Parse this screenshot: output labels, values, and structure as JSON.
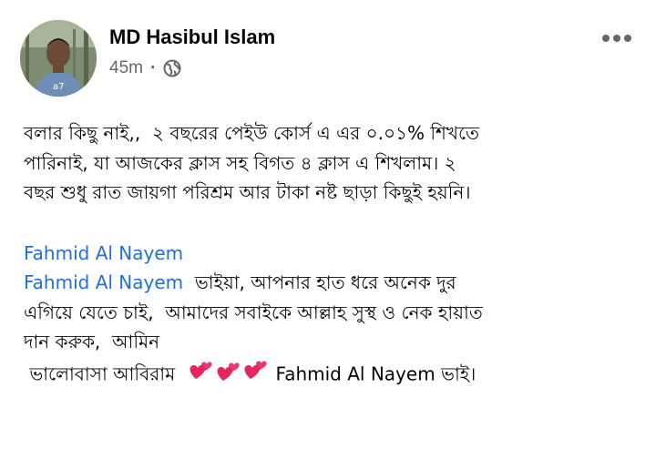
{
  "post": {
    "author": "MD Hasibul Islam",
    "time": "45m",
    "privacy_icon": "globe-icon",
    "menu_icon": "more-horizontal-icon",
    "paragraph1": "বলার কিছু নাই,,  ২ বছরের পেইউ কোর্স এ এর ০.০১% শিখতে\nপারিনাই, যা আজকের ক্লাস সহ বিগত ৪ ক্লাস এ শিখলাম। ২\nবছর শুধু রাত জায়গা পরিশ্রম আর টাকা নষ্ট ছাড়া কিছুই হয়নি।",
    "mention_1": "Fahmid Al Nayem",
    "mention_2": "Fahmid Al Nayem",
    "line_after_mention": "  ভাইয়া, আপনার হাত ধরে অনেক দুর",
    "paragraph2_rest": "এগিয়ে যেতে চাই,  আমাদের সবাইকে আল্লাহ সুস্থ ও নেক হায়াত\nদান করুক,  আমিন",
    "last_line_prefix": " ভালোবাসা আবিরাম ",
    "hearts_emoji": "two-hearts-emoji",
    "mention_3": "Fahmid Al Nayem",
    "last_line_suffix": " ভাই।",
    "colors": {
      "link": "#216fdb",
      "meta": "#65676b",
      "text": "#050505"
    }
  }
}
